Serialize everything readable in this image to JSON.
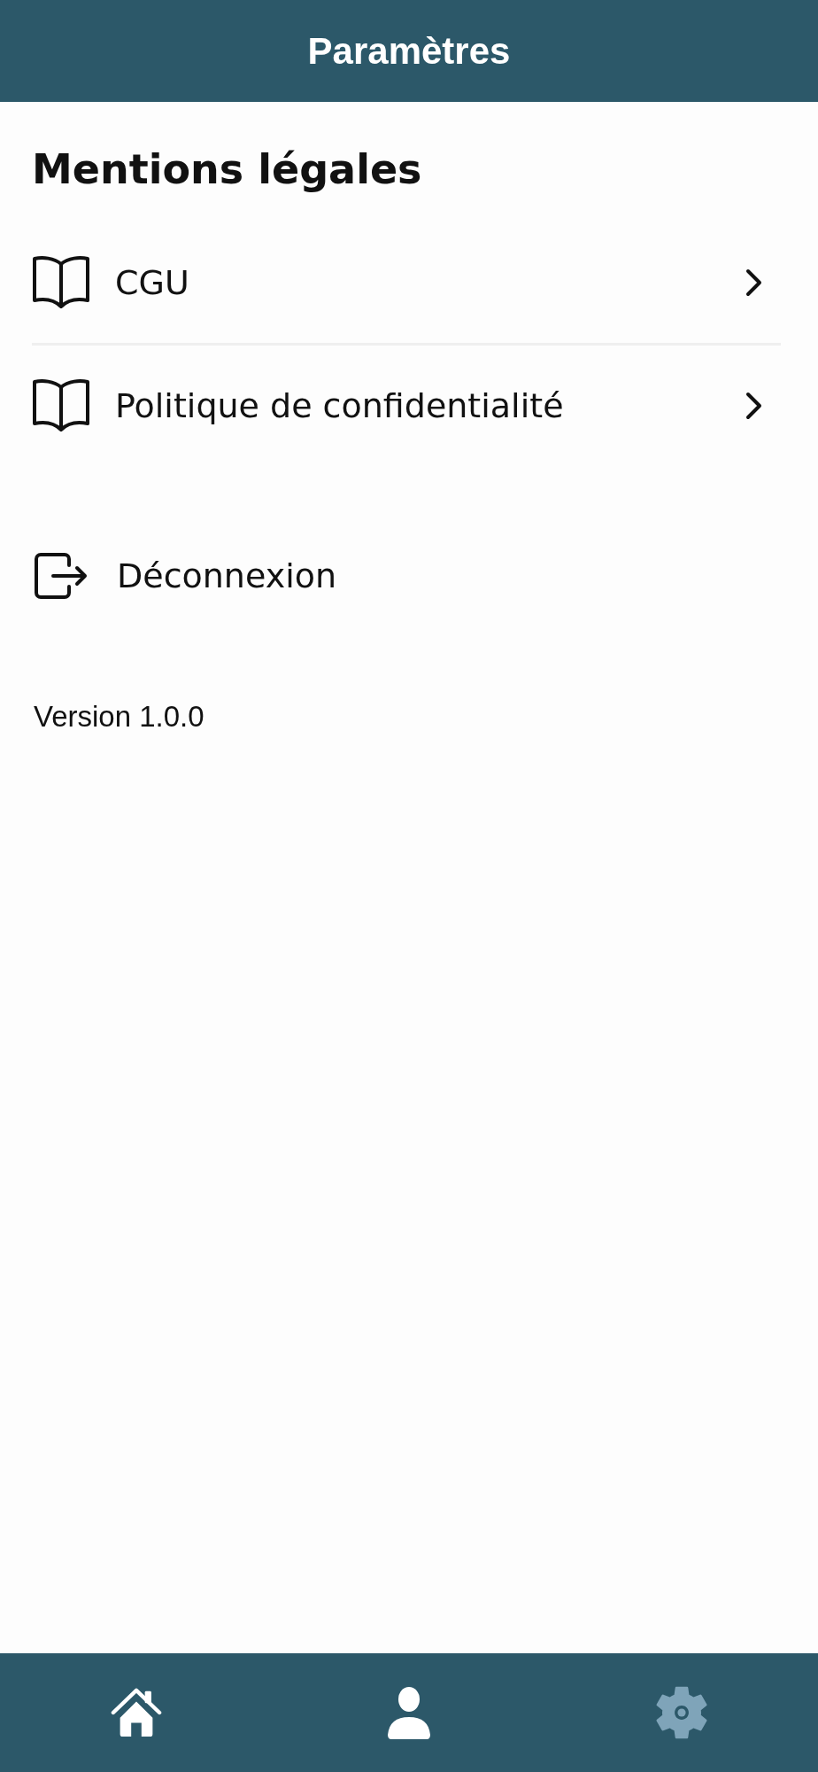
{
  "header": {
    "title": "Paramètres"
  },
  "legal_section": {
    "title": "Mentions légales",
    "items": [
      {
        "label": "CGU"
      },
      {
        "label": "Politique de confidentialité"
      }
    ]
  },
  "logout": {
    "label": "Déconnexion"
  },
  "version": "Version 1.0.0",
  "tab_bar": {
    "tabs": [
      {
        "kind": "home",
        "selected": false
      },
      {
        "kind": "profile",
        "selected": false
      },
      {
        "kind": "settings",
        "selected": true
      }
    ]
  }
}
